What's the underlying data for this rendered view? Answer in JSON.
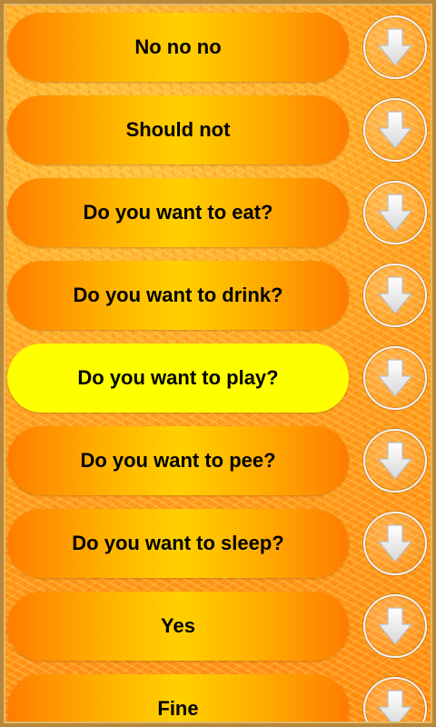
{
  "list": {
    "items": [
      {
        "label": "No no no",
        "selected": false,
        "action_icon": "download-arrow-icon"
      },
      {
        "label": "Should not",
        "selected": false,
        "action_icon": "download-arrow-icon"
      },
      {
        "label": "Do you want to eat?",
        "selected": false,
        "action_icon": "download-arrow-icon"
      },
      {
        "label": "Do you want to drink?",
        "selected": false,
        "action_icon": "download-arrow-icon"
      },
      {
        "label": "Do you want to play?",
        "selected": true,
        "action_icon": "download-arrow-icon"
      },
      {
        "label": "Do you want to pee?",
        "selected": false,
        "action_icon": "download-arrow-icon"
      },
      {
        "label": "Do you want to sleep?",
        "selected": false,
        "action_icon": "download-arrow-icon"
      },
      {
        "label": "Yes",
        "selected": false,
        "action_icon": "download-arrow-icon"
      },
      {
        "label": "Fine",
        "selected": false,
        "action_icon": "download-arrow-icon"
      }
    ]
  },
  "colors": {
    "pill_edge": "#ff7c00",
    "pill_center": "#ffd000",
    "selected_pill": "#ffff00",
    "background": "#ff9a1a",
    "frame": "#b8873a"
  }
}
